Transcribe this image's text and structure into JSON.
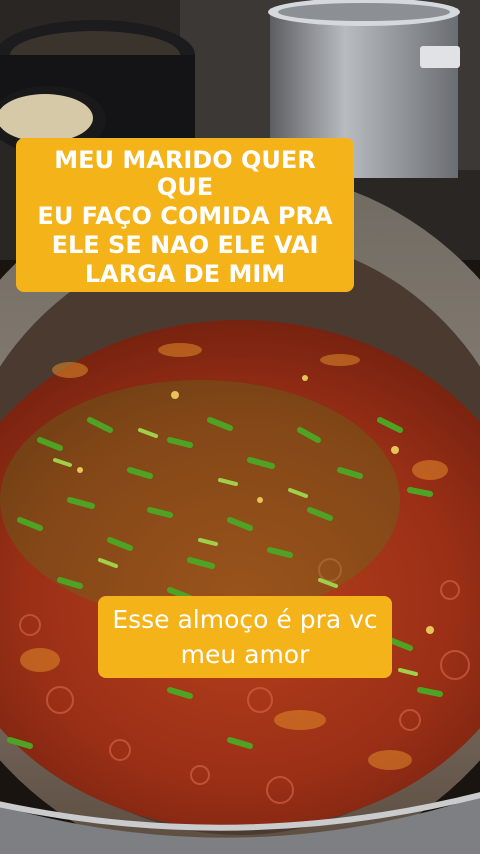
{
  "captions": {
    "top_lines": [
      "MEU MARIDO QUER QUE",
      "EU FAÇO COMIDA PRA",
      "ELE SE NAO ELE VAI",
      "LARGA DE MIM"
    ],
    "bottom_lines": [
      "Esse almoço é pra vc",
      "meu amor"
    ]
  },
  "colors": {
    "caption_bg": "#f5b31a",
    "caption_text": "#ffffff",
    "broth": "#a8341a",
    "scallion": "#3f8f1d"
  }
}
